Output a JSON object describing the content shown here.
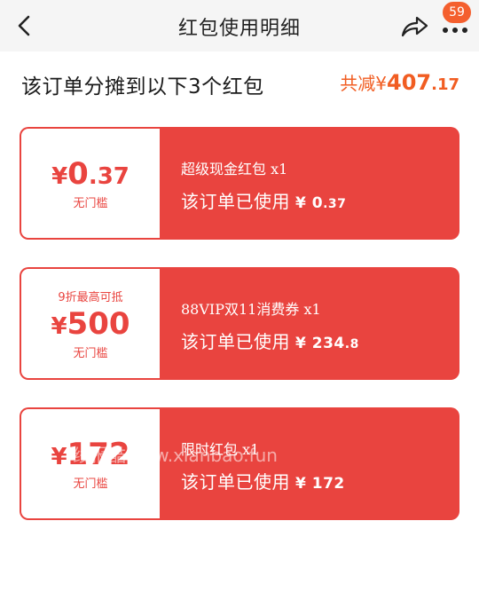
{
  "nav": {
    "title": "红包使用明细",
    "badge": "59"
  },
  "summary": {
    "title": "该订单分摊到以下3个红包",
    "total_prefix": "共减",
    "currency": "¥",
    "total_int": "407",
    "total_dec": ".17"
  },
  "coupons": [
    {
      "top_label": "",
      "currency": "¥",
      "amount_int": "0",
      "amount_dec": ".37",
      "threshold": "无门槛",
      "name": "超级现金红包 x1",
      "usage_label": "该订单已使用",
      "used_currency": "¥",
      "used_int": "0",
      "used_dec": ".37"
    },
    {
      "top_label": "9折最高可抵",
      "currency": "¥",
      "amount_int": "500",
      "amount_dec": "",
      "threshold": "无门槛",
      "name": "88VIP双11消费券 x1",
      "usage_label": "该订单已使用",
      "used_currency": "¥",
      "used_int": "234",
      "used_dec": ".8"
    },
    {
      "top_label": "",
      "currency": "¥",
      "amount_int": "172",
      "amount_dec": "",
      "threshold": "无门槛",
      "name": "限时红包 x1",
      "usage_label": "该订单已使用",
      "used_currency": "¥",
      "used_int": "172",
      "used_dec": ""
    }
  ],
  "watermark": "线报酷-new.xianbao.fun",
  "colors": {
    "accent": "#e9443f",
    "total": "#f15d22",
    "badge": "#f45f2e"
  }
}
